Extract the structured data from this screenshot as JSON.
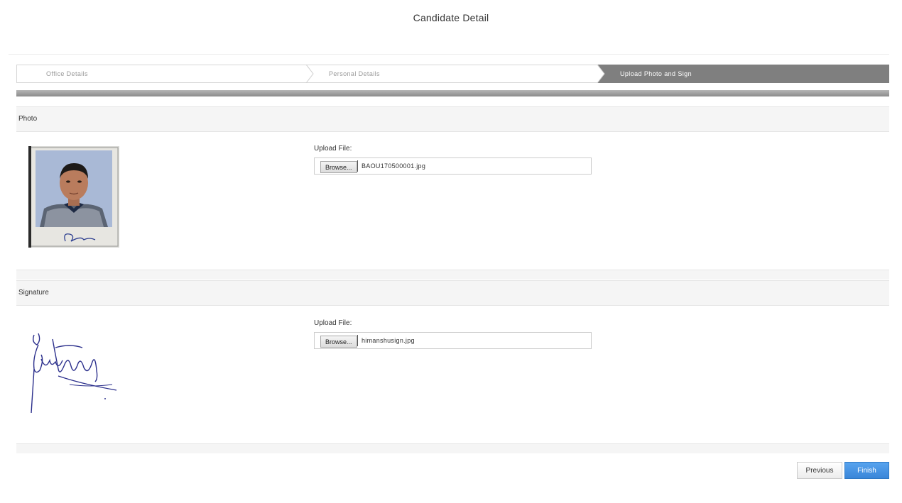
{
  "page": {
    "title": "Candidate Detail"
  },
  "wizard": {
    "steps": [
      {
        "label": "Office Details",
        "active": false
      },
      {
        "label": "Personal Details",
        "active": false
      },
      {
        "label": "Upload Photo and Sign",
        "active": true
      }
    ]
  },
  "photo_section": {
    "heading": "Photo",
    "upload_label": "Upload File:",
    "browse_label": "Browse...",
    "file_name": "BAOU170500001.jpg"
  },
  "signature_section": {
    "heading": "Signature",
    "upload_label": "Upload File:",
    "browse_label": "Browse...",
    "file_name": "himanshusign.jpg"
  },
  "actions": {
    "previous_label": "Previous",
    "finish_label": "Finish"
  },
  "colors": {
    "active_step": "#7f7f7f",
    "finish_button": "#3a86d9",
    "section_bg": "#f5f5f5"
  }
}
